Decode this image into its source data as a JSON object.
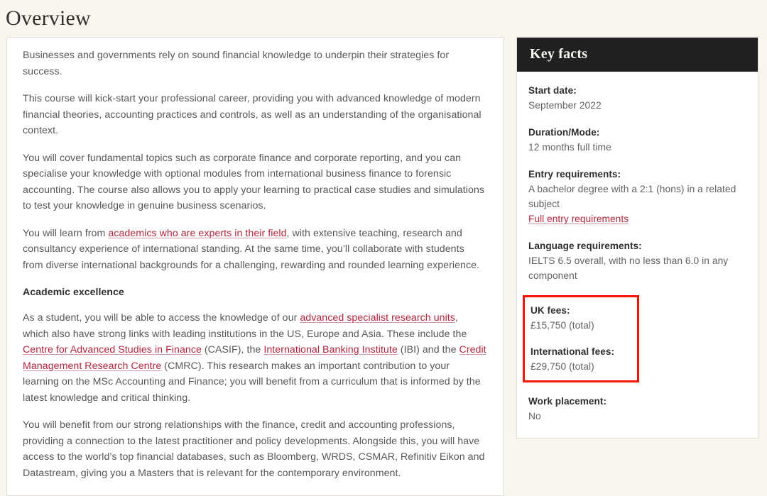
{
  "page": {
    "title": "Overview",
    "accent_link_color": "#b4243c",
    "highlight_box_color": "#fb1100",
    "background_color": "#f9f5ef",
    "card_background_color": "#ffffff",
    "header_background_color": "#202020"
  },
  "overview": {
    "paragraph_1": "Businesses and governments rely on sound financial knowledge to underpin their strategies for success.",
    "paragraph_2": "This course will kick-start your professional career, providing you with advanced knowledge of modern financial theories, accounting practices and controls, as well as an understanding of the organisational context.",
    "paragraph_3": "You will cover fundamental topics such as corporate finance and corporate reporting, and you can specialise your knowledge with optional modules from international business finance to forensic accounting. The course also allows you to apply your learning to practical case studies and simulations to test your knowledge in genuine business scenarios.",
    "paragraph_4_part_1": "You will learn from ",
    "paragraph_4_link": "academics who are experts in their field",
    "paragraph_4_part_2": ", with extensive teaching, research and consultancy experience of international standing. At the same time, you’ll collaborate with students from diverse international backgrounds for a challenging, rewarding and rounded learning experience.",
    "subheading": "Academic excellence",
    "paragraph_5_part_1": "As a student, you will be able to access the knowledge of our ",
    "paragraph_5_link_1": "advanced specialist research units",
    "paragraph_5_part_2": ", which also have strong links with leading institutions in the US, Europe and Asia. These include the ",
    "paragraph_5_link_2": "Centre for Advanced Studies in Finance",
    "paragraph_5_part_3": " (CASIF), the ",
    "paragraph_5_link_3": "International Banking Institute",
    "paragraph_5_part_4": " (IBI) and the ",
    "paragraph_5_link_4": "Credit Management Research Centre",
    "paragraph_5_part_5": " (CMRC). This research makes an important contribution to your learning on the MSc Accounting and Finance; you will benefit from a curriculum that is informed by the latest knowledge and critical thinking.",
    "paragraph_6": "You will benefit from our strong relationships with the finance, credit and accounting professions, providing a connection to the latest practitioner and policy developments. Alongside this, you will have access to the world’s top financial databases, such as Bloomberg, WRDS, CSMAR, Refinitiv Eikon and Datastream, giving you a Masters that is relevant for the contemporary environment."
  },
  "key_facts": {
    "header_title": "Key facts",
    "start_date": {
      "label": "Start date:",
      "value": "September 2022"
    },
    "duration_mode": {
      "label": "Duration/Mode:",
      "value": "12 months full time"
    },
    "entry_requirements": {
      "label": "Entry requirements:",
      "value": "A bachelor degree with a 2:1 (hons) in a related subject",
      "link": "Full entry requirements"
    },
    "language_requirements": {
      "label": "Language requirements:",
      "value": "IELTS 6.5 overall, with no less than 6.0 in any component"
    },
    "uk_fees": {
      "label": "UK fees:",
      "value": "£15,750 (total)"
    },
    "international_fees": {
      "label": "International fees:",
      "value": "£29,750 (total)"
    },
    "work_placement": {
      "label": "Work placement:",
      "value": "No"
    }
  }
}
